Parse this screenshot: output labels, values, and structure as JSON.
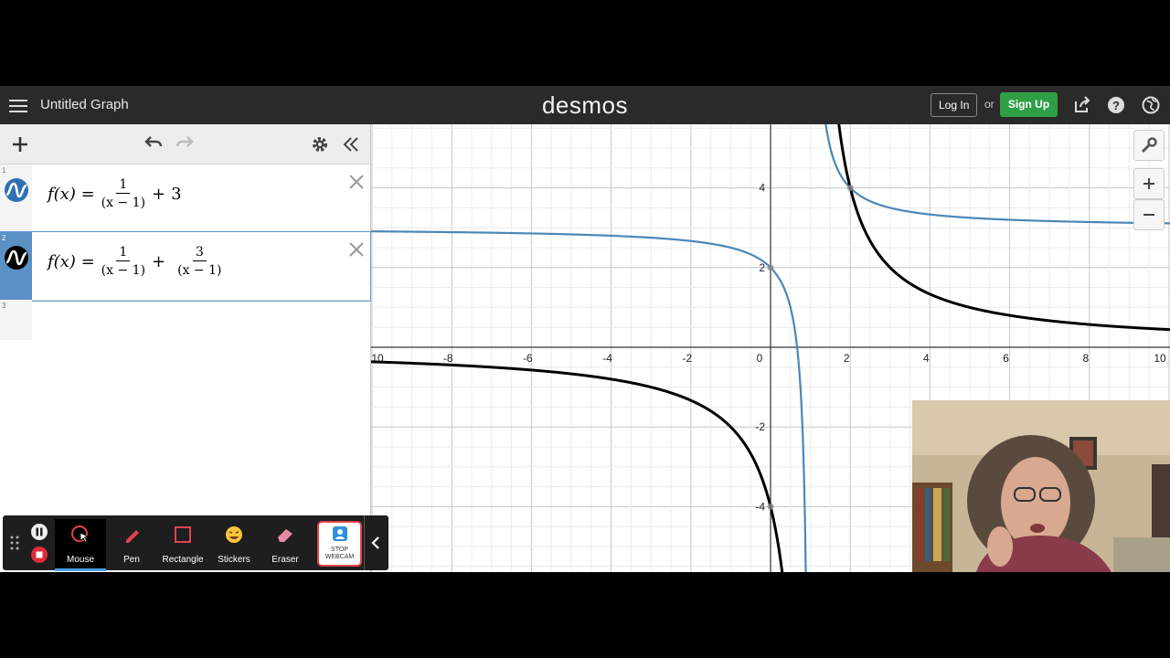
{
  "header": {
    "graph_title": "Untitled Graph",
    "brand": "desmos",
    "login_label": "Log In",
    "or_text": "or",
    "signup_label": "Sign Up"
  },
  "expressions": [
    {
      "number": "1",
      "color": "#2d70b3",
      "lhs": "f(x) =",
      "term1_num": "1",
      "term1_den": "(x − 1)",
      "op": "+",
      "term2": "3"
    },
    {
      "number": "2",
      "color": "#000000",
      "lhs": "f(x) =",
      "term1_num": "1",
      "term1_den": "(x − 1)",
      "op": "+",
      "term2_num": "3",
      "term2_den": "(x − 1)"
    },
    {
      "number": "3"
    }
  ],
  "graph": {
    "x_ticks": [
      "-10",
      "-8",
      "-6",
      "-4",
      "-2",
      "0",
      "2",
      "4",
      "6",
      "8",
      "10"
    ],
    "y_ticks": [
      "4",
      "2",
      "-2",
      "-4"
    ],
    "x_range": [
      -10.0,
      10.0
    ],
    "y_range": [
      -5.6,
      5.6
    ],
    "series": [
      {
        "name": "1/(x-1)+3",
        "color": "#4a87b8",
        "asymptote_x": 1,
        "a": 1,
        "b": 3
      },
      {
        "name": "1/(x-1)+3/(x-1)",
        "color": "#000000",
        "asymptote_x": 1,
        "a": 4,
        "b": 0
      }
    ]
  },
  "recorder": {
    "tools": [
      "Mouse",
      "Pen",
      "Rectangle",
      "Stickers",
      "Eraser"
    ],
    "webcam_label_1": "STOP",
    "webcam_label_2": "WEBCAM"
  }
}
